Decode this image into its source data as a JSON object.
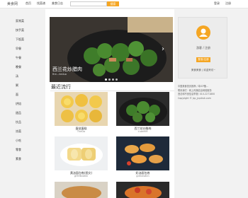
{
  "header": {
    "logo": "美食网",
    "nav": [
      "首页",
      "找菜谱",
      "美食日志"
    ],
    "search_button": "搜索",
    "user_links": [
      "登录",
      "注册"
    ]
  },
  "sidebar": {
    "items": [
      "家常菜",
      "快手菜",
      "下饭菜",
      "早餐",
      "午餐",
      "晚餐",
      "汤",
      "粥",
      "面",
      "烘焙",
      "甜品",
      "饮品",
      "凉菜",
      "小吃",
      "零食",
      "素食"
    ]
  },
  "carousel": {
    "title": "西兰花炒腊肉",
    "subtitle": "fire…iieduo",
    "dots": 4
  },
  "section": {
    "title": "最近流行"
  },
  "cards": [
    {
      "title": "蛋挞蛋糕",
      "author": "TheDa"
    },
    {
      "title": "西兰花炒腊肉",
      "author": "cuteMM"
    },
    {
      "title": "黄油面包卷(图文)",
      "author": "gf3HBa80n"
    },
    {
      "title": "奶油面包卷",
      "author": "gdmes80n"
    }
  ],
  "profile": {
    "guest": "游客 / 注册",
    "login_button": "登录/注册",
    "welcome": "美食美食 | 欢迎来访~"
  },
  "footer_info": {
    "line1": "中国美食首页推荐 / 粤ICP备...",
    "line2": "联系我们 · 网上传播信息网络服务",
    "line3": "违法和不良信息举报: 010-2271800",
    "copyright": "Copyright © jcp_jcpdruk.com"
  }
}
